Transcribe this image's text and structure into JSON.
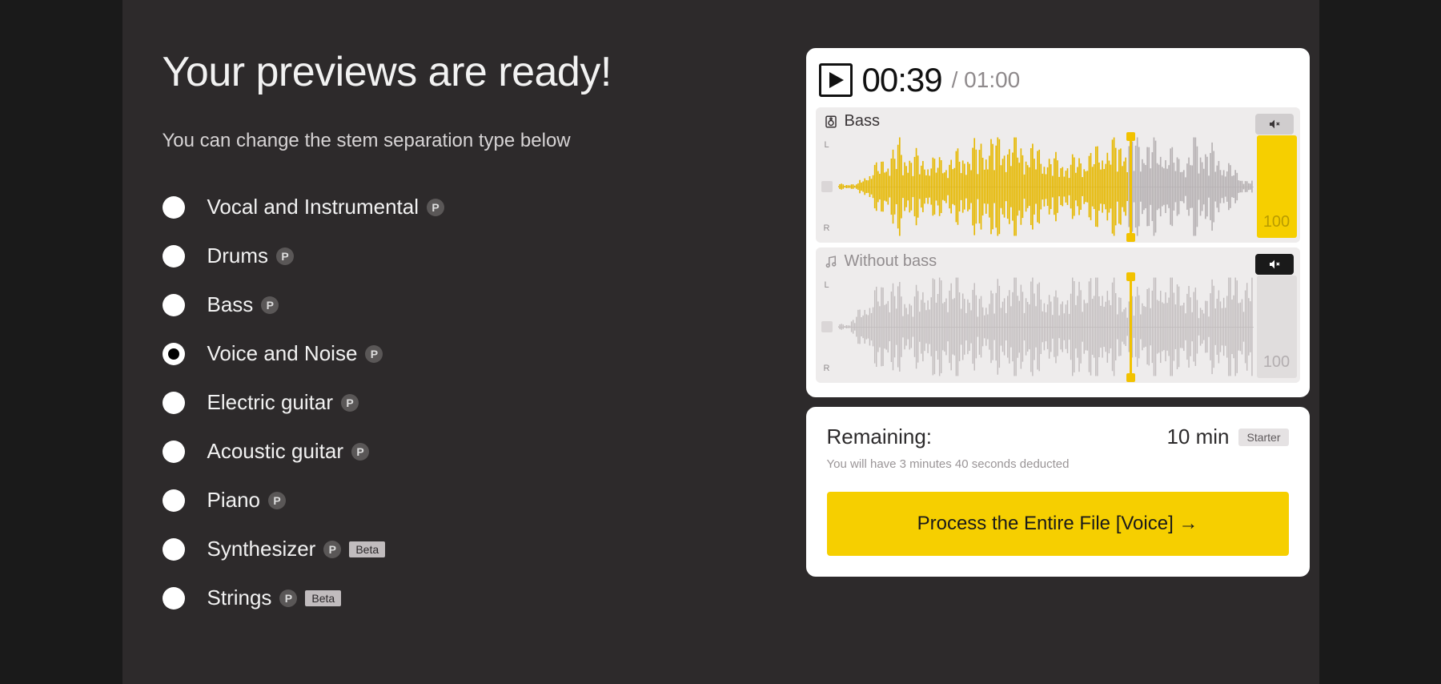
{
  "header": {
    "title": "Your previews are ready!"
  },
  "subtitle": "You can change the stem separation type below",
  "options": [
    {
      "label": "Vocal and Instrumental",
      "p": true,
      "beta": false,
      "selected": false
    },
    {
      "label": "Drums",
      "p": true,
      "beta": false,
      "selected": false
    },
    {
      "label": "Bass",
      "p": true,
      "beta": false,
      "selected": false
    },
    {
      "label": "Voice and Noise",
      "p": true,
      "beta": false,
      "selected": true
    },
    {
      "label": "Electric guitar",
      "p": true,
      "beta": false,
      "selected": false
    },
    {
      "label": "Acoustic guitar",
      "p": true,
      "beta": false,
      "selected": false
    },
    {
      "label": "Piano",
      "p": true,
      "beta": false,
      "selected": false
    },
    {
      "label": "Synthesizer",
      "p": true,
      "beta": true,
      "selected": false
    },
    {
      "label": "Strings",
      "p": true,
      "beta": true,
      "selected": false
    }
  ],
  "beta_text": "Beta",
  "p_text": "P",
  "player": {
    "current": "00:39",
    "total": "01:00",
    "tracks": [
      {
        "title": "Bass",
        "muted": false,
        "volume": "100"
      },
      {
        "title": "Without bass",
        "muted": true,
        "volume": "100"
      }
    ],
    "channels": {
      "left": "L",
      "right": "R"
    }
  },
  "remaining": {
    "label": "Remaining:",
    "time": "10 min",
    "plan": "Starter",
    "note": "You will have 3 minutes 40 seconds deducted"
  },
  "process_button": "Process the Entire File [Voice] →"
}
